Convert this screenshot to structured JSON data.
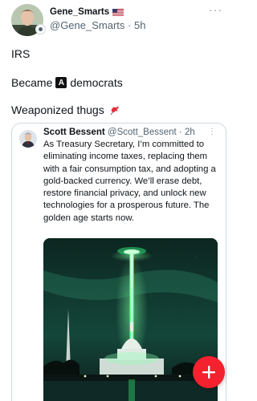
{
  "post": {
    "author": {
      "name": "Gene_Smarts",
      "handle": "@Gene_Smarts",
      "time": "· 5h",
      "flag_icon": "us-flag-icon"
    },
    "lines": {
      "l1": "IRS",
      "l2_before": "Became",
      "l2_badge": "A",
      "l2_after": "democrats",
      "l3": "Weaponized thugs"
    },
    "more_label": "···"
  },
  "quote": {
    "author": {
      "name": "Scott Bessent",
      "handle": "@Scott_Bessent · 2h"
    },
    "more_label": "⋮",
    "text": "As Treasury Secretary, I’m committed to eliminating income taxes, replacing them with a fair consumption tax, and adopting a gold-backed currency. We’ll erase debt, restore financial privacy, and unlock new technologies for a prosperous future. The golden age starts now."
  },
  "fab": {
    "label": "+"
  },
  "colors": {
    "fab": "#f4212e",
    "muted": "#536471",
    "border": "#cfd9de"
  }
}
